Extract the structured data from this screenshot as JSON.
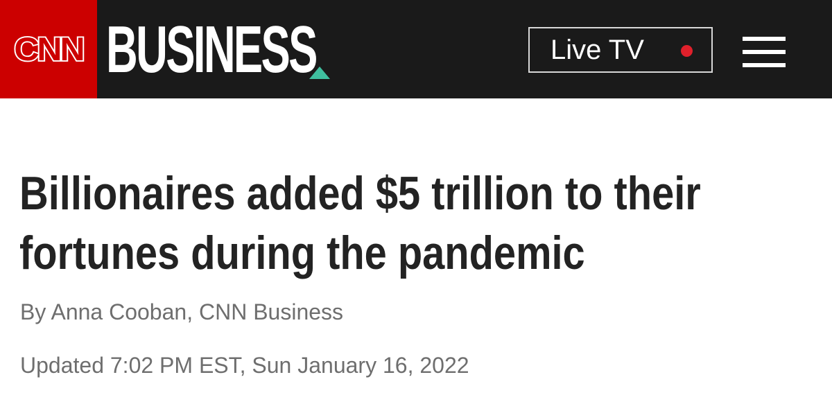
{
  "header": {
    "logo_text": "CNN",
    "section": "BUSINESS",
    "live_tv_label": "Live TV",
    "menu_icon": "hamburger-menu-icon"
  },
  "article": {
    "headline": "Billionaires added $5 trillion to their fortunes during the pandemic",
    "byline": "By Anna Cooban, CNN Business",
    "updated": "Updated 7:02 PM EST, Sun January 16, 2022"
  },
  "colors": {
    "brand_red": "#cc0000",
    "header_bg": "#1a1a1a",
    "accent_teal": "#3fbf9f",
    "live_dot": "#e0202b",
    "headline": "#232323",
    "meta_text": "#6e6e6e"
  }
}
